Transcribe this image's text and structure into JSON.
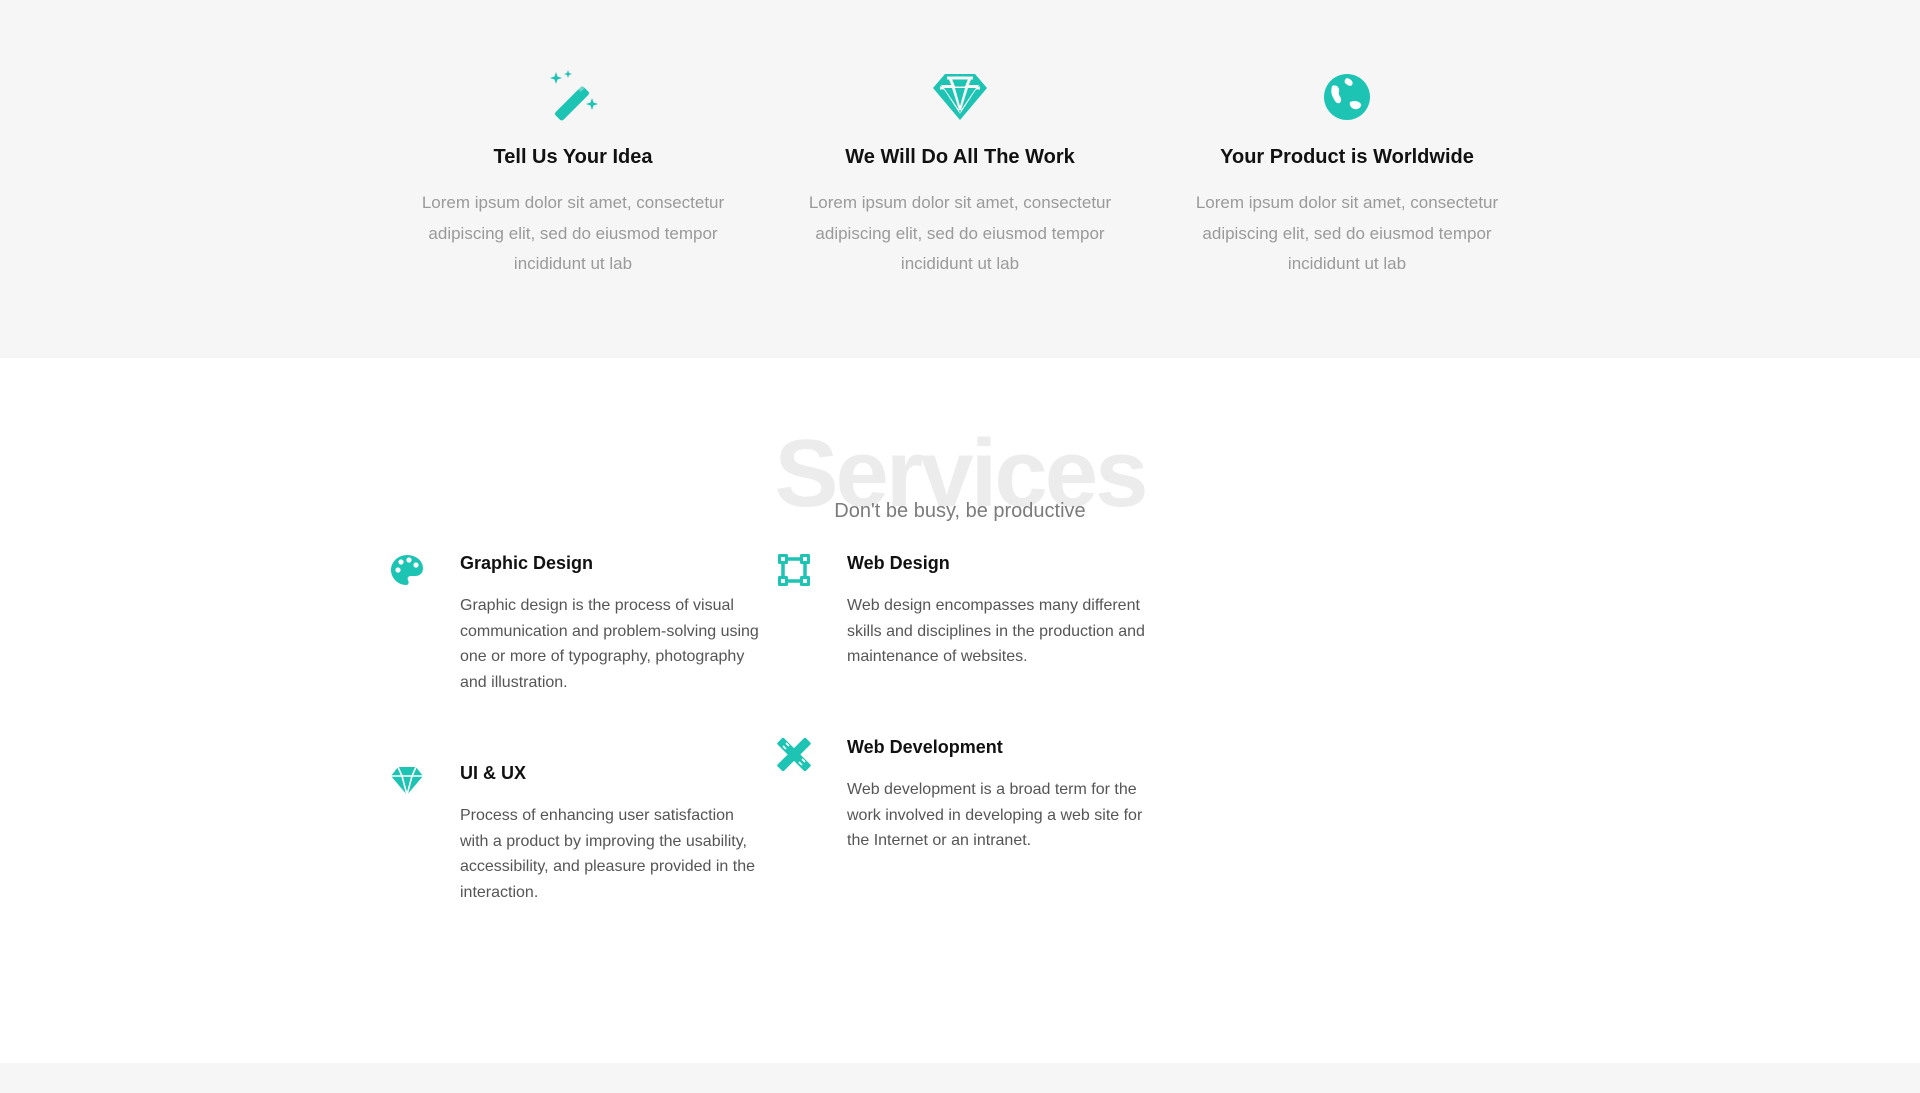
{
  "colors": {
    "accent": "#1dc4b3",
    "feature_bg": "#f6f6f6",
    "heading": "#111111",
    "muted_text": "#9a9a9a",
    "body_text": "#555555"
  },
  "features": [
    {
      "icon": "magic-wand-icon",
      "title": "Tell Us Your Idea",
      "text": "Lorem ipsum dolor sit amet, consectetur adipiscing elit, sed do eiusmod tempor incididunt ut lab"
    },
    {
      "icon": "diamond-icon",
      "title": "We Will Do All The Work",
      "text": "Lorem ipsum dolor sit amet, consectetur adipiscing elit, sed do eiusmod tempor incididunt ut lab"
    },
    {
      "icon": "globe-icon",
      "title": "Your Product is Worldwide",
      "text": "Lorem ipsum dolor sit amet, consectetur adipiscing elit, sed do eiusmod tempor incididunt ut lab"
    }
  ],
  "services": {
    "title": "Services",
    "subtitle": "Don't be busy, be productive",
    "items": [
      {
        "icon": "palette-icon",
        "title": "Graphic Design",
        "text": "Graphic design is the process of visual communication and problem-solving using one or more of typography, photography and illustration."
      },
      {
        "icon": "vector-square-icon",
        "title": "Web Design",
        "text": "Web design encompasses many different skills and disciplines in the production and maintenance of websites."
      },
      {
        "icon": "gem-icon",
        "title": "UI & UX",
        "text": "Process of enhancing user satisfaction with a product by improving the usability, accessibility, and pleasure provided in the interaction."
      },
      {
        "icon": "pencil-ruler-icon",
        "title": "Web Development",
        "text": "Web development is a broad term for the work involved in developing a web site for the Internet or an intranet."
      }
    ]
  }
}
